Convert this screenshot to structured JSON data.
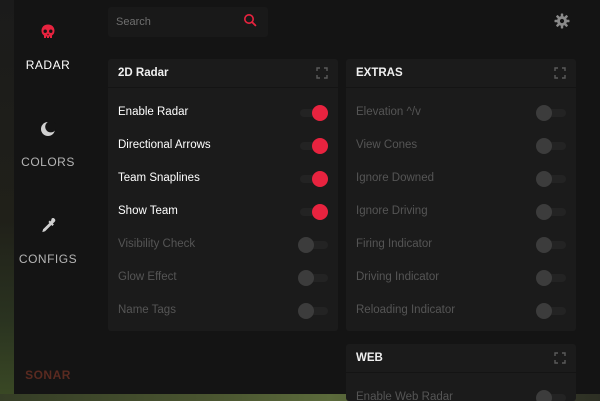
{
  "colors": {
    "accent": "#e8233f",
    "panel": "#1b1b1b",
    "background": "#141414"
  },
  "sidebar": {
    "items": [
      {
        "label": "RADAR",
        "icon": "skull-icon",
        "active": true
      },
      {
        "label": "COLORS",
        "icon": "moon-icon",
        "active": false
      },
      {
        "label": "CONFIGS",
        "icon": "pipette-icon",
        "active": false
      }
    ],
    "brand": "SONAR"
  },
  "search": {
    "placeholder": "Search",
    "value": ""
  },
  "panels": {
    "radar": {
      "title": "2D Radar",
      "items": [
        {
          "label": "Enable Radar",
          "on": true
        },
        {
          "label": "Directional Arrows",
          "on": true
        },
        {
          "label": "Team Snaplines",
          "on": true
        },
        {
          "label": "Show Team",
          "on": true
        },
        {
          "label": "Visibility Check",
          "on": false
        },
        {
          "label": "Glow Effect",
          "on": false
        },
        {
          "label": "Name Tags",
          "on": false
        }
      ]
    },
    "extras": {
      "title": "EXTRAS",
      "items": [
        {
          "label": "Elevation ^/v",
          "on": false
        },
        {
          "label": "View Cones",
          "on": false
        },
        {
          "label": "Ignore Downed",
          "on": false
        },
        {
          "label": "Ignore Driving",
          "on": false
        },
        {
          "label": "Firing Indicator",
          "on": false
        },
        {
          "label": "Driving Indicator",
          "on": false
        },
        {
          "label": "Reloading Indicator",
          "on": false
        }
      ]
    },
    "web": {
      "title": "WEB",
      "items": [
        {
          "label": "Enable Web Radar",
          "on": false
        }
      ]
    }
  }
}
